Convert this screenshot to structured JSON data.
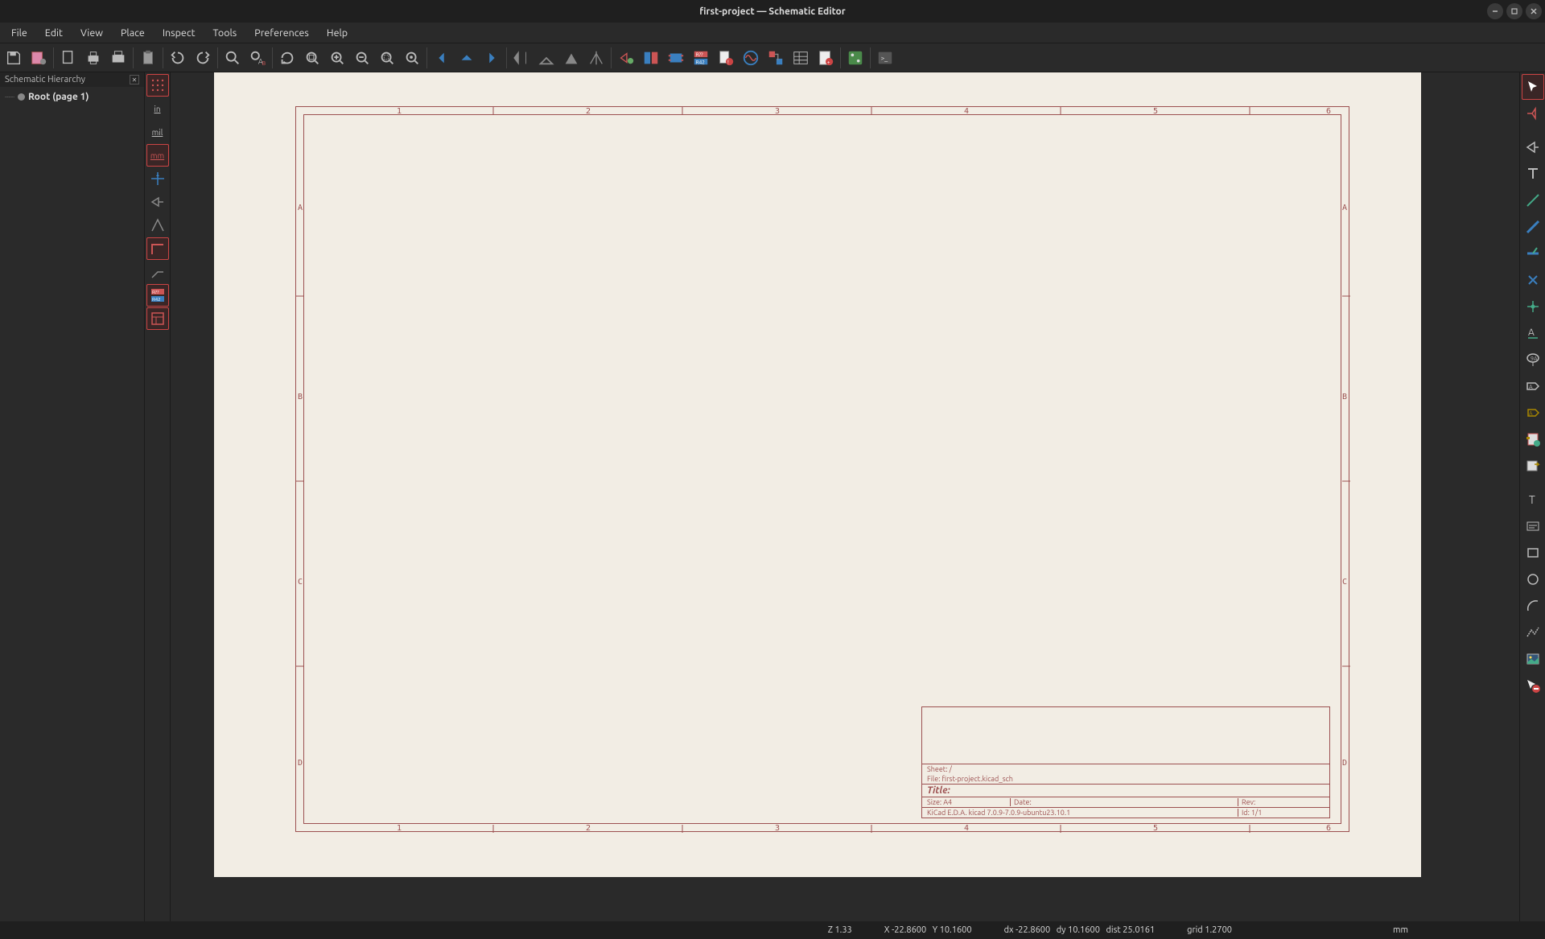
{
  "titlebar": {
    "title": "first-project — Schematic Editor"
  },
  "menu": [
    "File",
    "Edit",
    "View",
    "Place",
    "Inspect",
    "Tools",
    "Preferences",
    "Help"
  ],
  "left_panel": {
    "header": "Schematic Hierarchy",
    "root_label": "Root (page 1)"
  },
  "left_vtoolbar": {
    "unit_in": "in",
    "unit_mil": "mil",
    "unit_mm": "mm"
  },
  "sheet": {
    "col_marks": [
      "1",
      "2",
      "3",
      "4",
      "5",
      "6"
    ],
    "row_marks": [
      "A",
      "B",
      "C",
      "D"
    ],
    "titleblock": {
      "sheet_label": "Sheet: /",
      "file_label": "File: first-project.kicad_sch",
      "title_label": "Title:",
      "size_label": "Size: A4",
      "date_label": "Date:",
      "rev_label": "Rev:",
      "app_label": "KiCad E.D.A.   kicad 7.0.9-7.0.9-ubuntu23.10.1",
      "id_label": "Id: 1/1"
    }
  },
  "status": {
    "zoom": "Z 1.33",
    "xy": "X -22.8600   Y 10.1600",
    "dxy": "dx -22.8600   dy 10.1600   dist 25.0161",
    "grid": "grid 1.2700",
    "unit": "mm"
  }
}
